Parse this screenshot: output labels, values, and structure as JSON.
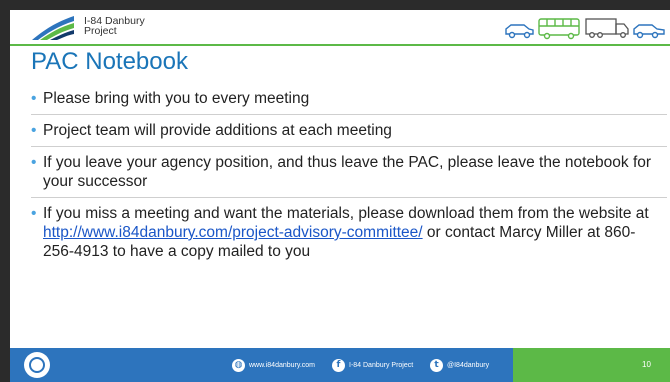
{
  "header": {
    "logo_line1": "I-84 Danbury",
    "logo_line2": "Project",
    "vehicle_icons": [
      "car-icon",
      "bus-icon",
      "truck-icon",
      "car-icon"
    ]
  },
  "slide": {
    "title": "PAC Notebook",
    "bullets": [
      {
        "text": "Please bring with you to every meeting"
      },
      {
        "text": "Project team will provide additions at each meeting"
      },
      {
        "text": "If you leave your agency position, and thus leave the PAC, please leave the notebook for your successor"
      },
      {
        "text_before": "If you miss a meeting and want the materials, please download them from the website at ",
        "link": "http://www.i84danbury.com/project-advisory-committee/",
        "text_after": " or contact Marcy Miller at 860-256-4913 to have a copy mailed to you"
      }
    ]
  },
  "footer": {
    "website": "www.i84danbury.com",
    "facebook": "I-84 Danbury Project",
    "twitter": "@I84danbury",
    "page_number": "10",
    "colors": {
      "blue": "#2d74bd",
      "green": "#5cb947"
    }
  }
}
